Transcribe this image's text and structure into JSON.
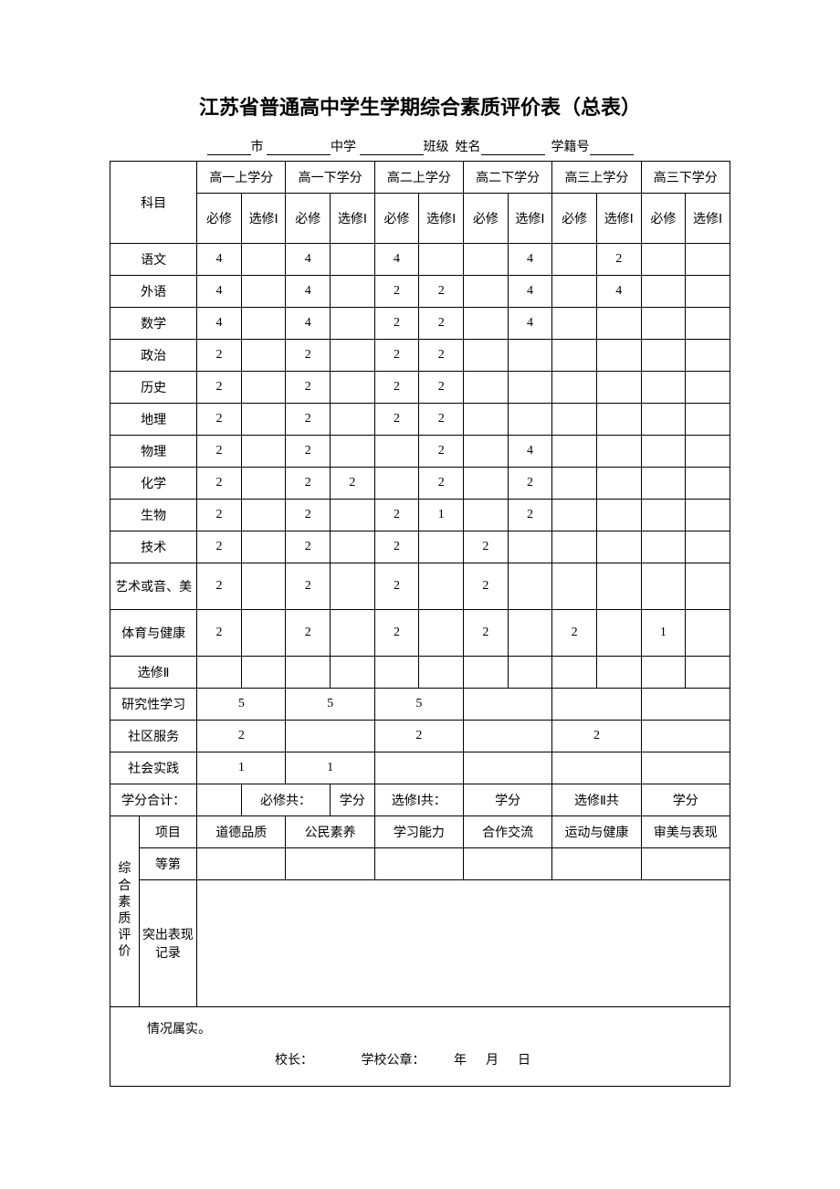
{
  "title": "江苏省普通高中学生学期综合素质评价表（总表）",
  "info": {
    "city_suffix": "市",
    "school_suffix": "中学",
    "class_label": "班级",
    "name_label": "姓名",
    "stuno_label": "学籍号"
  },
  "headers": {
    "subject": "科目",
    "sem": [
      "高一上学分",
      "高一下学分",
      "高二上学分",
      "高二下学分",
      "高三上学分",
      "高三下学分"
    ],
    "req": "必修",
    "opt": "选修Ⅰ"
  },
  "subjects": [
    {
      "name": "语文",
      "v": [
        "4",
        "",
        "4",
        "",
        "4",
        "",
        "",
        "4",
        "",
        "2",
        "",
        ""
      ]
    },
    {
      "name": "外语",
      "v": [
        "4",
        "",
        "4",
        "",
        "2",
        "2",
        "",
        "4",
        "",
        "4",
        "",
        ""
      ]
    },
    {
      "name": "数学",
      "v": [
        "4",
        "",
        "4",
        "",
        "2",
        "2",
        "",
        "4",
        "",
        "",
        "",
        ""
      ]
    },
    {
      "name": "政治",
      "v": [
        "2",
        "",
        "2",
        "",
        "2",
        "2",
        "",
        "",
        "",
        "",
        "",
        ""
      ]
    },
    {
      "name": "历史",
      "v": [
        "2",
        "",
        "2",
        "",
        "2",
        "2",
        "",
        "",
        "",
        "",
        "",
        ""
      ]
    },
    {
      "name": "地理",
      "v": [
        "2",
        "",
        "2",
        "",
        "2",
        "2",
        "",
        "",
        "",
        "",
        "",
        ""
      ]
    },
    {
      "name": "物理",
      "v": [
        "2",
        "",
        "2",
        "",
        "",
        "2",
        "",
        "4",
        "",
        "",
        "",
        ""
      ]
    },
    {
      "name": "化学",
      "v": [
        "2",
        "",
        "2",
        "2",
        "",
        "2",
        "",
        "2",
        "",
        "",
        "",
        ""
      ]
    },
    {
      "name": "生物",
      "v": [
        "2",
        "",
        "2",
        "",
        "2",
        "1",
        "",
        "2",
        "",
        "",
        "",
        ""
      ]
    },
    {
      "name": "技术",
      "v": [
        "2",
        "",
        "2",
        "",
        "2",
        "",
        "2",
        "",
        "",
        "",
        "",
        ""
      ]
    },
    {
      "name": "艺术或音、美",
      "v": [
        "2",
        "",
        "2",
        "",
        "2",
        "",
        "2",
        "",
        "",
        "",
        "",
        ""
      ]
    },
    {
      "name": "体育与健康",
      "v": [
        "2",
        "",
        "2",
        "",
        "2",
        "",
        "2",
        "",
        "2",
        "",
        "1",
        ""
      ]
    },
    {
      "name": "选修Ⅱ",
      "v": [
        "",
        "",
        "",
        "",
        "",
        "",
        "",
        "",
        "",
        "",
        "",
        ""
      ]
    }
  ],
  "merged": [
    {
      "name": "研究性学习",
      "v": [
        "5",
        "5",
        "5",
        "",
        "",
        ""
      ]
    },
    {
      "name": "社区服务",
      "v": [
        "2",
        "",
        "2",
        "",
        "2",
        ""
      ]
    },
    {
      "name": "社会实践",
      "v": [
        "1",
        "1",
        "",
        "",
        "",
        ""
      ]
    }
  ],
  "totals": {
    "label": "学分合计：",
    "req": "必修共：",
    "opt1": "选修Ⅰ共：",
    "opt2": "选修Ⅱ共",
    "credit": "学分"
  },
  "quality": {
    "group": "综合素质评价",
    "item": "项目",
    "grade": "等第",
    "record": "突出表现记录",
    "cols": [
      "道德品质",
      "公民素养",
      "学习能力",
      "合作交流",
      "运动与健康",
      "审美与表现"
    ]
  },
  "sig": {
    "confirm": "情况属实。",
    "principal": "校长：",
    "seal": "学校公章：",
    "year": "年",
    "month": "月",
    "day": "日"
  }
}
